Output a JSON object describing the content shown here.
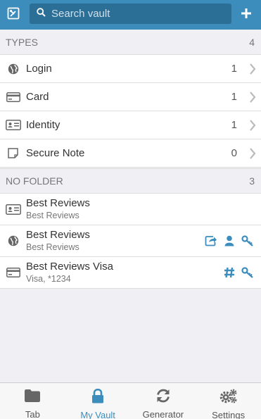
{
  "header": {
    "search_placeholder": "Search vault",
    "accent_color": "#3c8dbc",
    "left_icon": "popout-icon",
    "right_icon": "add-icon"
  },
  "types": {
    "title": "TYPES",
    "count": "4",
    "items": [
      {
        "label": "Login",
        "count": "1",
        "icon": "globe-icon"
      },
      {
        "label": "Card",
        "count": "1",
        "icon": "credit-card-icon"
      },
      {
        "label": "Identity",
        "count": "1",
        "icon": "id-card-icon"
      },
      {
        "label": "Secure Note",
        "count": "0",
        "icon": "sticky-note-icon"
      }
    ]
  },
  "no_folder": {
    "title": "NO FOLDER",
    "count": "3",
    "items": [
      {
        "name": "Best Reviews",
        "subtitle": "Best Reviews",
        "icon": "id-card-icon",
        "actions": []
      },
      {
        "name": "Best Reviews",
        "subtitle": "Best Reviews",
        "icon": "globe-icon",
        "actions": [
          "launch-icon",
          "copy-username-icon",
          "copy-password-icon"
        ]
      },
      {
        "name": "Best Reviews Visa",
        "subtitle": "Visa, *1234",
        "icon": "credit-card-icon",
        "actions": [
          "copy-number-icon",
          "copy-code-icon"
        ]
      }
    ]
  },
  "tabs": [
    {
      "label": "Tab",
      "icon": "folder-icon",
      "active": false
    },
    {
      "label": "My Vault",
      "icon": "lock-icon",
      "active": true
    },
    {
      "label": "Generator",
      "icon": "refresh-icon",
      "active": false
    },
    {
      "label": "Settings",
      "icon": "cogs-icon",
      "active": false
    }
  ]
}
